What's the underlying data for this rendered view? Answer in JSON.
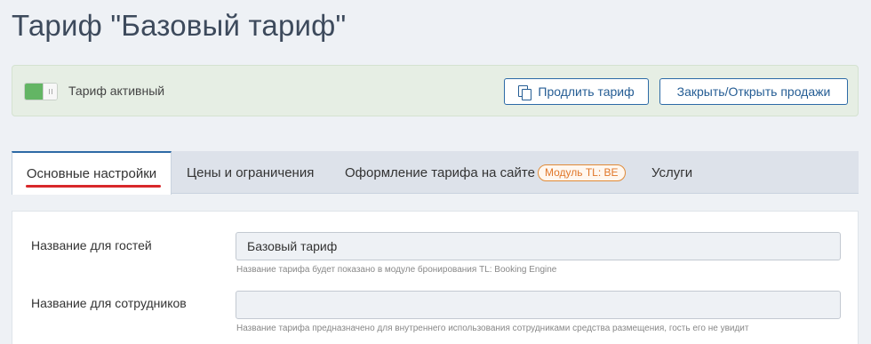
{
  "page": {
    "title": "Тариф \"Базовый тариф\""
  },
  "status": {
    "toggle_on": true,
    "label": "Тариф активный",
    "extend_button": "Продлить тариф",
    "sales_button": "Закрыть/Открыть продажи",
    "accent_color": "#63b564"
  },
  "tabs": [
    {
      "label": "Основные настройки",
      "active": true
    },
    {
      "label": "Цены и ограничения"
    },
    {
      "label": "Оформление тарифа на сайте",
      "badge": "Модуль TL: BE"
    },
    {
      "label": "Услуги"
    }
  ],
  "form": {
    "guest_name": {
      "label": "Название для гостей",
      "value": "Базовый тариф",
      "hint": "Название тарифа будет показано в модуле бронирования TL: Booking Engine"
    },
    "staff_name": {
      "label": "Название для сотрудников",
      "value": "",
      "hint": "Название тарифа предназначено для внутреннего использования сотрудниками средства размещения, гость его не увидит"
    }
  }
}
